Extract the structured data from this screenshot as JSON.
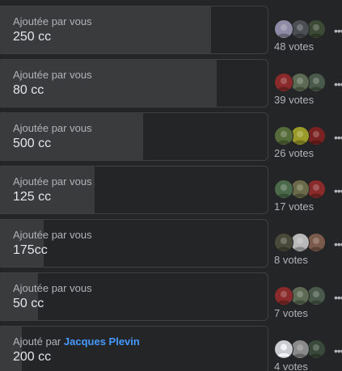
{
  "options": [
    {
      "label": "Ajoutée par vous",
      "value": "250 cc",
      "votes": "48 votes",
      "share": 0.79,
      "avatars": [
        {
          "icon": "voter-avatar",
          "color": "#8f8aa6"
        },
        {
          "icon": "voter-avatar",
          "color": "#4b4f54"
        },
        {
          "icon": "voter-avatar",
          "color": "#3c4a35"
        }
      ]
    },
    {
      "label": "Ajoutée par vous",
      "value": "80 cc",
      "votes": "39 votes",
      "share": 0.81,
      "avatars": [
        {
          "icon": "voter-avatar",
          "color": "#8a2a2a"
        },
        {
          "icon": "voter-avatar",
          "color": "#5d6b54"
        },
        {
          "icon": "voter-avatar",
          "color": "#4a5a4a"
        }
      ]
    },
    {
      "label": "Ajoutée par vous",
      "value": "500 cc",
      "votes": "26 votes",
      "share": 0.54,
      "avatars": [
        {
          "icon": "voter-avatar",
          "color": "#566b3a"
        },
        {
          "icon": "voter-avatar",
          "color": "#9a9a2a"
        },
        {
          "icon": "voter-avatar",
          "color": "#7a2222"
        }
      ]
    },
    {
      "label": "Ajoutée par vous",
      "value": "125 cc",
      "votes": "17 votes",
      "share": 0.36,
      "avatars": [
        {
          "icon": "voter-avatar",
          "color": "#4a6a4a"
        },
        {
          "icon": "voter-avatar",
          "color": "#6a6a4a"
        },
        {
          "icon": "voter-avatar",
          "color": "#8a2a2a"
        }
      ]
    },
    {
      "label": "Ajoutée par vous",
      "value": "175cc",
      "votes": "8 votes",
      "share": 0.17,
      "avatars": [
        {
          "icon": "voter-avatar",
          "color": "#4a4a3a"
        },
        {
          "icon": "voter-avatar",
          "color": "#b8b8b8"
        },
        {
          "icon": "voter-avatar",
          "color": "#7a5a4a"
        }
      ]
    },
    {
      "label": "Ajoutée par vous",
      "value": "50 cc",
      "votes": "7 votes",
      "share": 0.15,
      "avatars": [
        {
          "icon": "voter-avatar",
          "color": "#8a2a2a"
        },
        {
          "icon": "voter-avatar",
          "color": "#5d6b54"
        },
        {
          "icon": "voter-avatar",
          "color": "#4a5a4a"
        }
      ]
    },
    {
      "label": "Ajouté par",
      "author": "Jacques Plevin",
      "value": "200 cc",
      "votes": "4 votes",
      "share": 0.09,
      "avatars": [
        {
          "icon": "default-avatar",
          "color": "#c9ccd1"
        },
        {
          "icon": "voter-avatar",
          "color": "#8a8a8a"
        },
        {
          "icon": "voter-avatar",
          "color": "#3a4a3a"
        }
      ]
    }
  ],
  "colors": {
    "background": "#242526",
    "bar_fill": "#3a3b3c",
    "author_link": "#4599ff"
  }
}
